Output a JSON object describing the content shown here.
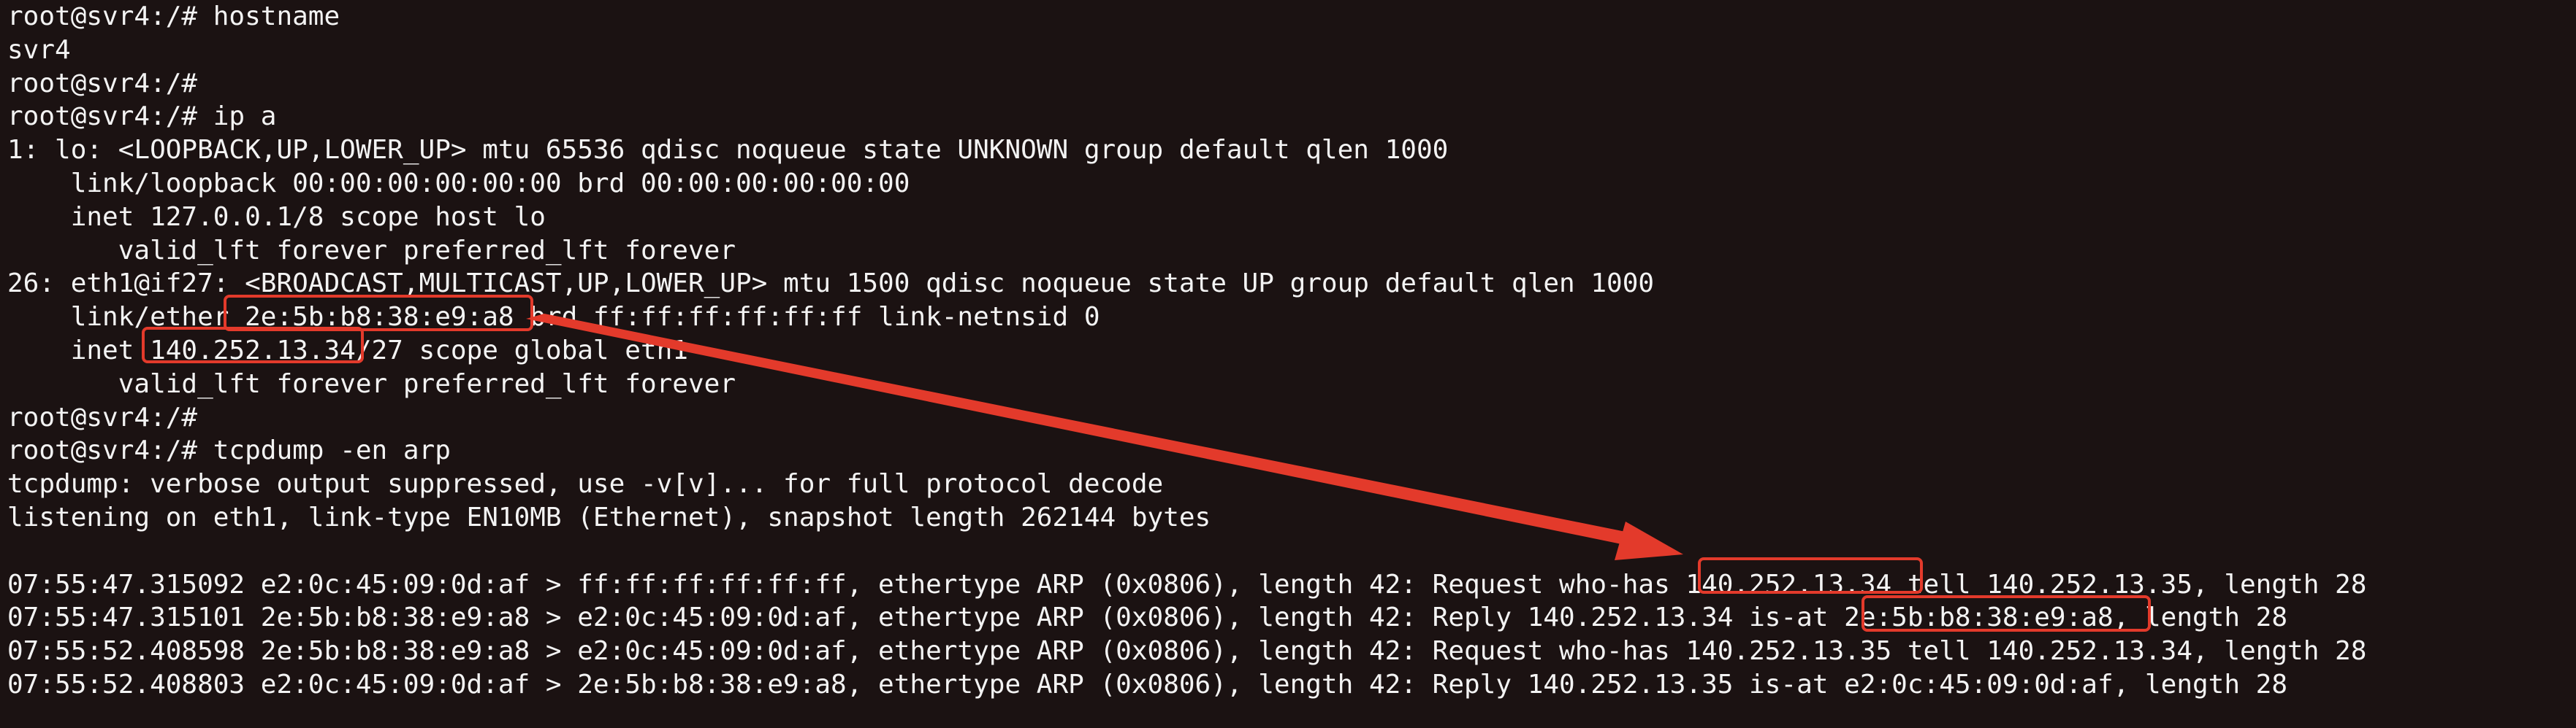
{
  "terminal": {
    "lines": [
      "root@svr4:/# hostname",
      "svr4",
      "root@svr4:/#",
      "root@svr4:/# ip a",
      "1: lo: <LOOPBACK,UP,LOWER_UP> mtu 65536 qdisc noqueue state UNKNOWN group default qlen 1000",
      "    link/loopback 00:00:00:00:00:00 brd 00:00:00:00:00:00",
      "    inet 127.0.0.1/8 scope host lo",
      "       valid_lft forever preferred_lft forever",
      "26: eth1@if27: <BROADCAST,MULTICAST,UP,LOWER_UP> mtu 1500 qdisc noqueue state UP group default qlen 1000",
      "    link/ether 2e:5b:b8:38:e9:a8 brd ff:ff:ff:ff:ff:ff link-netnsid 0",
      "    inet 140.252.13.34/27 scope global eth1",
      "       valid_lft forever preferred_lft forever",
      "root@svr4:/#",
      "root@svr4:/# tcpdump -en arp",
      "tcpdump: verbose output suppressed, use -v[v]... for full protocol decode",
      "listening on eth1, link-type EN10MB (Ethernet), snapshot length 262144 bytes",
      "",
      "07:55:47.315092 e2:0c:45:09:0d:af > ff:ff:ff:ff:ff:ff, ethertype ARP (0x0806), length 42: Request who-has 140.252.13.34 tell 140.252.13.35, length 28",
      "07:55:47.315101 2e:5b:b8:38:e9:a8 > e2:0c:45:09:0d:af, ethertype ARP (0x0806), length 42: Reply 140.252.13.34 is-at 2e:5b:b8:38:e9:a8, length 28",
      "07:55:52.408598 2e:5b:b8:38:e9:a8 > e2:0c:45:09:0d:af, ethertype ARP (0x0806), length 42: Request who-has 140.252.13.35 tell 140.252.13.34, length 28",
      "07:55:52.408803 e2:0c:45:09:0d:af > 2e:5b:b8:38:e9:a8, ethertype ARP (0x0806), length 42: Reply 140.252.13.35 is-at e2:0c:45:09:0d:af, length 28"
    ]
  },
  "colors": {
    "background": "#1b1212",
    "text": "#f3f3f3",
    "annotation": "#e33a2b"
  }
}
